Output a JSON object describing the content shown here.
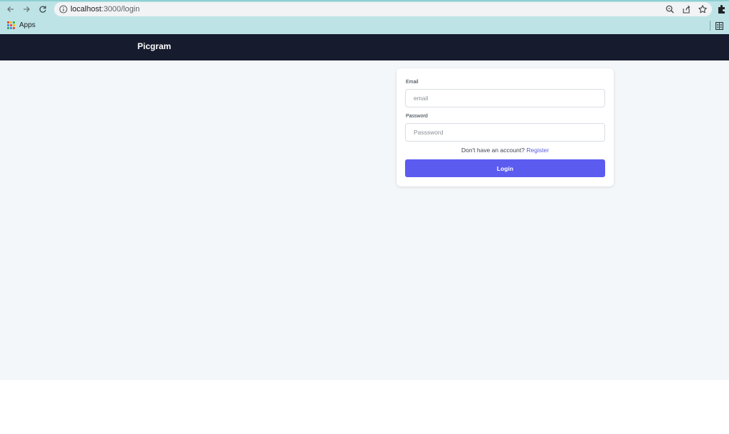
{
  "browser": {
    "url_host": "localhost",
    "url_path": ":3000/login",
    "bookmarks": {
      "apps_label": "Apps"
    }
  },
  "app": {
    "brand": "Picgram"
  },
  "login": {
    "email_label": "Email",
    "email_placeholder": "email",
    "password_label": "Password",
    "password_placeholder": "Passsword",
    "register_prompt": "Don't have an account?",
    "register_link": "Register",
    "login_button": "Login"
  },
  "colors": {
    "navbar": "#161b2e",
    "primary": "#5b5bf0",
    "link": "#5a5bde",
    "page_bg": "#f4f7fa"
  }
}
